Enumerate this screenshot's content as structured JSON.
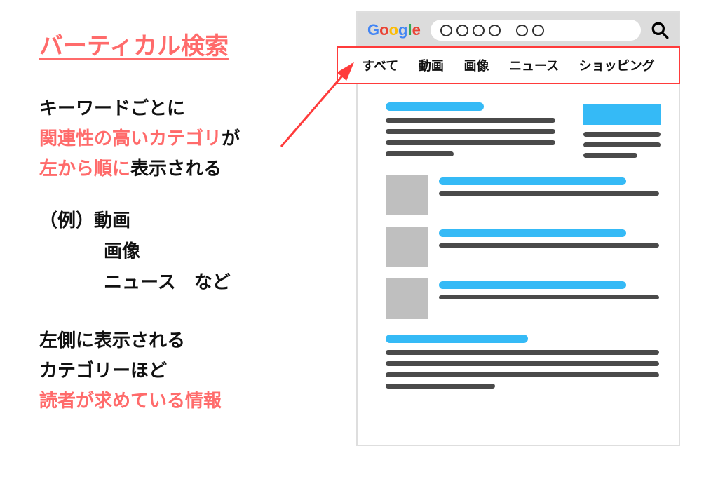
{
  "title": "バーティカル検索",
  "desc": {
    "line1": "キーワードごとに",
    "line2_red": "関連性の高いカテゴリ",
    "line2_black": "が",
    "line3_red": "左から順に",
    "line3_black": "表示される"
  },
  "example": {
    "label": "（例）",
    "item1": "動画",
    "item2": "画像",
    "item3": "ニュース",
    "suffix": "など"
  },
  "bottom": {
    "line1": "左側に表示される",
    "line2": "カテゴリーほど",
    "line3_red": "読者が求めている情報"
  },
  "mockup": {
    "logo": {
      "g1": "G",
      "o1": "o",
      "o2": "o",
      "g2": "g",
      "l": "l",
      "e": "e"
    },
    "search_placeholder": "〇〇〇〇　〇〇",
    "tabs": {
      "all": "すべて",
      "video": "動画",
      "image": "画像",
      "news": "ニュース",
      "shopping": "ショッピング"
    }
  }
}
